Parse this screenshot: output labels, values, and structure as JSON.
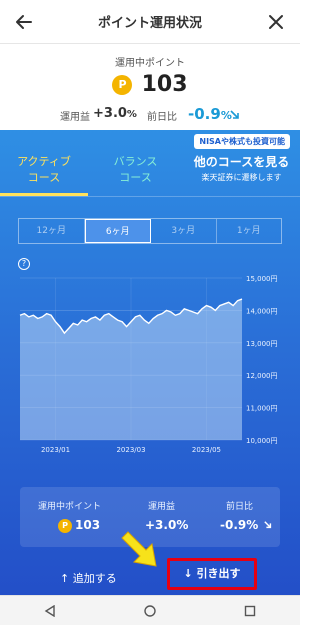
{
  "header": {
    "title": "ポイント運用状況",
    "back_icon": "back-arrow-icon",
    "close_icon": "close-icon"
  },
  "summary": {
    "label": "運用中ポイント",
    "points": "103",
    "coin_glyph": "P",
    "profit_label": "運用益",
    "profit_value": "+3.0",
    "profit_unit": "%",
    "dod_label": "前日比",
    "dod_value": "-0.9",
    "dod_unit": "%"
  },
  "nisa_badge": "NISAや株式も投資可能",
  "tabs": {
    "active": {
      "line1": "アクティブ",
      "line2": "コース"
    },
    "balance": {
      "line1": "バランス",
      "line2": "コース"
    },
    "other": {
      "line1": "他のコースを見る",
      "line2": "楽天証券に遷移します"
    }
  },
  "periods": [
    "12ヶ月",
    "6ヶ月",
    "3ヶ月",
    "1ヶ月"
  ],
  "selected_period": "6ヶ月",
  "chart_data": {
    "type": "area",
    "title": "",
    "xlabel": "",
    "ylabel": "",
    "y_ticks": [
      "15,000円",
      "14,000円",
      "13,000円",
      "12,000円",
      "11,000円",
      "10,000円"
    ],
    "x_ticks": [
      "2023/01",
      "2023/03",
      "2023/05"
    ],
    "ylim": [
      10000,
      15000
    ],
    "x": [
      0,
      1,
      2,
      3,
      4,
      5,
      6,
      7,
      8,
      9,
      10,
      11,
      12,
      13,
      14,
      15,
      16,
      17,
      18,
      19,
      20,
      21,
      22,
      23,
      24,
      25,
      26,
      27,
      28,
      29,
      30,
      31,
      32,
      33,
      34,
      35,
      36,
      37,
      38,
      39,
      40,
      41,
      42,
      43,
      44,
      45,
      46,
      47,
      48,
      49,
      50
    ],
    "values": [
      13850,
      13900,
      13800,
      13850,
      13750,
      13800,
      13900,
      13850,
      13650,
      13500,
      13300,
      13450,
      13600,
      13550,
      13700,
      13650,
      13750,
      13800,
      13700,
      13850,
      13900,
      13800,
      13700,
      13650,
      13500,
      13650,
      13800,
      13850,
      13700,
      13600,
      13750,
      13850,
      13900,
      14000,
      13950,
      13850,
      13900,
      14050,
      14000,
      13950,
      13900,
      14050,
      14150,
      14100,
      14000,
      14150,
      14200,
      14250,
      14150,
      14300,
      14350
    ],
    "grid": true,
    "colors": {
      "line": "#ffffff",
      "fill": "#b9d7f5"
    }
  },
  "card": {
    "points_label": "運用中ポイント",
    "points_value": "103",
    "profit_label": "運用益",
    "profit_value": "+3.0%",
    "dod_label": "前日比",
    "dod_value": "-0.9%"
  },
  "actions": {
    "add": "↑ 追加する",
    "withdraw": "↓ 引き出す"
  },
  "colors": {
    "accent": "#ffe25c",
    "balance": "#87f0d6",
    "highlight": "#e60012",
    "arrow": "#f7e21a",
    "blue_top": "#2f8fe4",
    "blue_bottom": "#234fc8"
  }
}
